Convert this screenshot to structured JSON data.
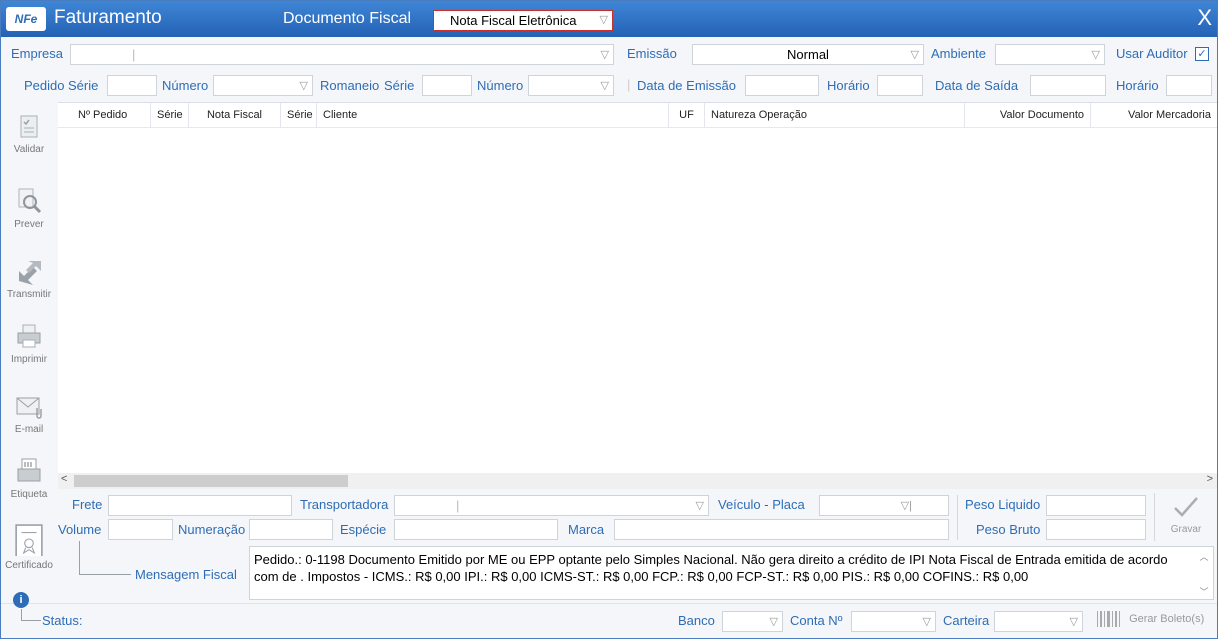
{
  "titlebar": {
    "logo": "NFe",
    "title": "Faturamento",
    "doc_label": "Documento Fiscal",
    "doc_value": "Nota Fiscal Eletrônica",
    "close": "X"
  },
  "filters1": {
    "empresa": "Empresa",
    "emissao": "Emissão",
    "emissao_value": "Normal",
    "ambiente": "Ambiente",
    "usar_auditor": "Usar Auditor"
  },
  "filters2": {
    "pedido": "Pedido",
    "serie1": "Série",
    "numero1": "Número",
    "romaneio": "Romaneio",
    "serie2": "Série",
    "numero2": "Número",
    "data_emissao": "Data de Emissão",
    "horario1": "Horário",
    "data_saida": "Data de Saída",
    "horario2": "Horário"
  },
  "grid": {
    "columns": [
      "Nº Pedido",
      "Série",
      "Nota Fiscal",
      "Série",
      "Cliente",
      "UF",
      "Natureza Operação",
      "Valor Documento",
      "Valor Mercadoria"
    ]
  },
  "sidebar": {
    "validar": "Validar",
    "prever": "Prever",
    "transmitir": "Transmitir",
    "imprimir": "Imprimir",
    "email": "E-mail",
    "etiqueta": "Etiqueta",
    "certificado": "Certificado"
  },
  "footer": {
    "frete": "Frete",
    "transportadora": "Transportadora",
    "veiculo": "Veículo - Placa",
    "peso_liquido": "Peso Liquido",
    "volume": "Volume",
    "numeracao": "Numeração",
    "especie": "Espécie",
    "marca": "Marca",
    "peso_bruto": "Peso Bruto",
    "gravar": "Gravar",
    "mensagem_label": "Mensagem Fiscal",
    "mensagem": "Pedido.: 0-1198 Documento Emitido por ME ou EPP optante pelo Simples Nacional. Não gera direito a crédito de IPI Nota Fiscal de Entrada emitida de acordo com    de .  Impostos - ICMS.: R$ 0,00 IPI.: R$ 0,00 ICMS-ST.: R$ 0,00 FCP.: R$ 0,00 FCP-ST.: R$ 0,00 PIS.: R$ 0,00 COFINS.: R$ 0,00"
  },
  "status": {
    "label": "Status:",
    "banco": "Banco",
    "conta": "Conta Nº",
    "carteira": "Carteira",
    "gerar": "Gerar Boleto(s)"
  },
  "colors": {
    "accent": "#2e6db6",
    "titlebar": "#2e72c6"
  }
}
